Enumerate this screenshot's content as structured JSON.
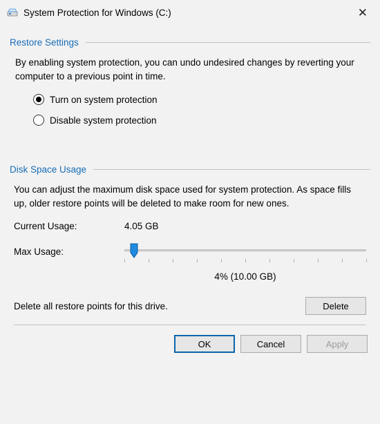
{
  "titlebar": {
    "title": "System Protection for Windows (C:)"
  },
  "restore": {
    "header": "Restore Settings",
    "description": "By enabling system protection, you can undo undesired changes by reverting your computer to a previous point in time.",
    "option_on": "Turn on system protection",
    "option_off": "Disable system protection"
  },
  "disk": {
    "header": "Disk Space Usage",
    "description": "You can adjust the maximum disk space used for system protection. As space fills up, older restore points will be deleted to make room for new ones.",
    "current_label": "Current Usage:",
    "current_value": "4.05 GB",
    "max_label": "Max Usage:",
    "slider_percent": 4,
    "slider_value_text": "4% (10.00 GB)",
    "delete_text": "Delete all restore points for this drive.",
    "delete_button": "Delete"
  },
  "buttons": {
    "ok": "OK",
    "cancel": "Cancel",
    "apply": "Apply"
  }
}
